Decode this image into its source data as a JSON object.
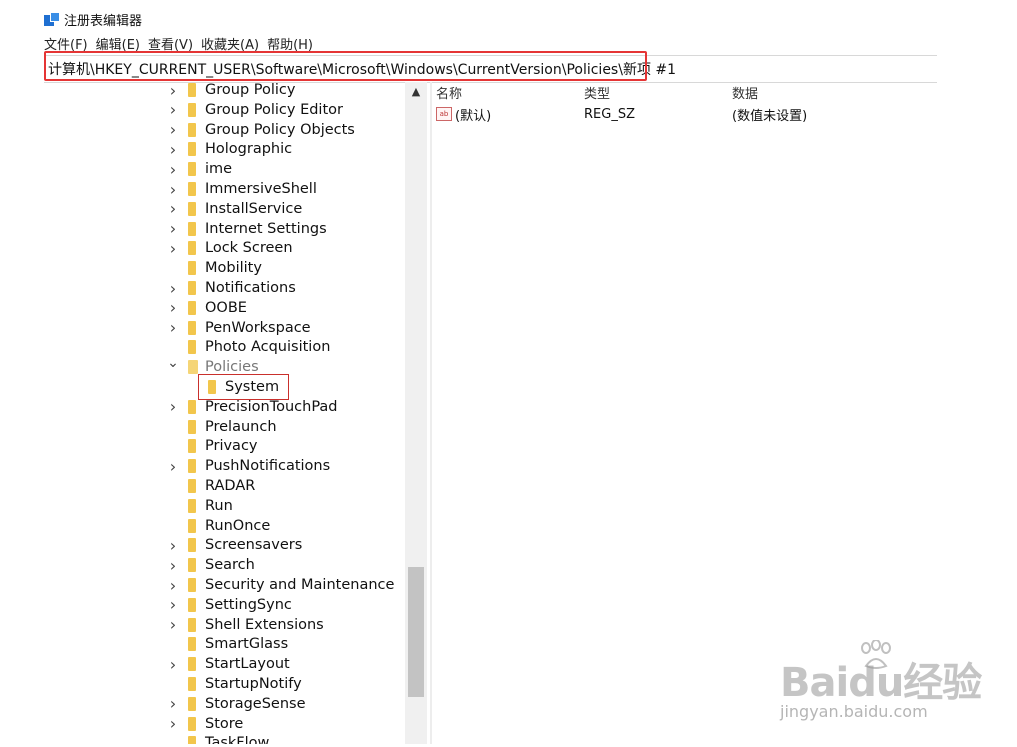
{
  "window": {
    "title": "注册表编辑器"
  },
  "menu": [
    "文件(F)",
    "编辑(E)",
    "查看(V)",
    "收藏夹(A)",
    "帮助(H)"
  ],
  "address": "计算机\\HKEY_CURRENT_USER\\Software\\Microsoft\\Windows\\CurrentVersion\\Policies\\新项 #1",
  "tree": [
    {
      "label": "Group Policy",
      "expand": true
    },
    {
      "label": "Group Policy Editor",
      "expand": true
    },
    {
      "label": "Group Policy Objects",
      "expand": true
    },
    {
      "label": "Holographic",
      "expand": true
    },
    {
      "label": "ime",
      "expand": true
    },
    {
      "label": "ImmersiveShell",
      "expand": true
    },
    {
      "label": "InstallService",
      "expand": true
    },
    {
      "label": "Internet Settings",
      "expand": true
    },
    {
      "label": "Lock Screen",
      "expand": true
    },
    {
      "label": "Mobility",
      "expand": false
    },
    {
      "label": "Notifications",
      "expand": true
    },
    {
      "label": "OOBE",
      "expand": true
    },
    {
      "label": "PenWorkspace",
      "expand": true
    },
    {
      "label": "Photo Acquisition",
      "expand": false
    },
    {
      "label": "Policies",
      "expand": "open"
    },
    {
      "label": "System",
      "expand": false,
      "child": true,
      "selected": true
    },
    {
      "label": "PrecisionTouchPad",
      "expand": true
    },
    {
      "label": "Prelaunch",
      "expand": false
    },
    {
      "label": "Privacy",
      "expand": false
    },
    {
      "label": "PushNotifications",
      "expand": true
    },
    {
      "label": "RADAR",
      "expand": false
    },
    {
      "label": "Run",
      "expand": false
    },
    {
      "label": "RunOnce",
      "expand": false
    },
    {
      "label": "Screensavers",
      "expand": true
    },
    {
      "label": "Search",
      "expand": true
    },
    {
      "label": "Security and Maintenance",
      "expand": true
    },
    {
      "label": "SettingSync",
      "expand": true
    },
    {
      "label": "Shell Extensions",
      "expand": true
    },
    {
      "label": "SmartGlass",
      "expand": false
    },
    {
      "label": "StartLayout",
      "expand": true
    },
    {
      "label": "StartupNotify",
      "expand": false
    },
    {
      "label": "StorageSense",
      "expand": true
    },
    {
      "label": "Store",
      "expand": true
    },
    {
      "label": "TaskFlow",
      "expand": false
    }
  ],
  "values_pane": {
    "columns": [
      "名称",
      "类型",
      "数据"
    ],
    "rows": [
      {
        "name": "(默认)",
        "type": "REG_SZ",
        "data": "(数值未设置)",
        "icon": "ab"
      }
    ]
  },
  "watermark": {
    "brand": "Baidu经验",
    "url": "jingyan.baidu.com"
  },
  "icons": {
    "expand": "chevron-right-icon",
    "collapse": "chevron-down-icon",
    "folder": "folder-icon",
    "string_value": "string-value-icon"
  },
  "colors": {
    "highlight": "#e53535",
    "folder": "#f2c64c"
  }
}
